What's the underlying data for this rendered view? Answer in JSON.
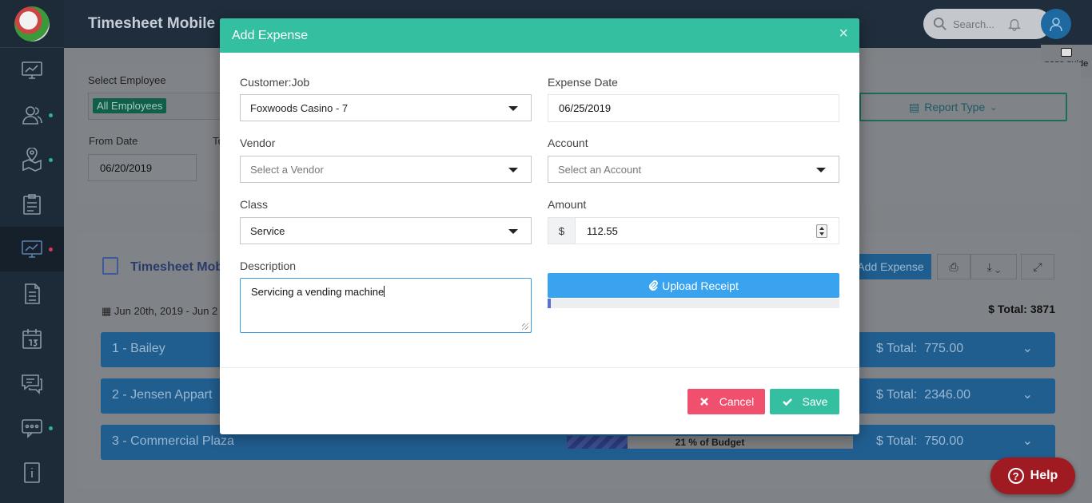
{
  "app": {
    "title": "Timesheet Mobile",
    "search_placeholder": "Search...",
    "page_guide": "page guide",
    "help_label": "Help"
  },
  "filters": {
    "select_employee_label": "Select Employee",
    "employee_chip": "All Employees",
    "from_date_label": "From Date",
    "to_date_label_partial": "To",
    "from_date_value": "06/20/2019",
    "report_type_label": "Report Type"
  },
  "main_card": {
    "title_partial": "Timesheet Mob",
    "add_expense_label": "Add Expense",
    "date_range_partial": "Jun 20th, 2019 - Jun 2",
    "total": "$ Total: 3871",
    "jobs": [
      {
        "name": "1 - Bailey",
        "total_label": "$ Total:",
        "total_value": "775.00"
      },
      {
        "name": "2 - Jensen Appart",
        "total_label": "$ Total:",
        "total_value": "2346.00"
      },
      {
        "name": "3 - Commercial Plaza",
        "total_label": "$ Total:",
        "total_value": "750.00",
        "budget_text": "21 % of Budget",
        "budget_fraction": 0.21
      }
    ]
  },
  "modal": {
    "title": "Add Expense",
    "close_glyph": "×",
    "customer_job_label": "Customer:Job",
    "customer_job_value": "Foxwoods Casino - 7",
    "expense_date_label": "Expense Date",
    "expense_date_value": "06/25/2019",
    "vendor_label": "Vendor",
    "vendor_placeholder": "Select a Vendor",
    "account_label": "Account",
    "account_placeholder": "Select an Account",
    "class_label": "Class",
    "class_value": "Service",
    "amount_label": "Amount",
    "amount_prefix": "$",
    "amount_value": "112.55",
    "description_label": "Description",
    "description_value": "Servicing a vending machine",
    "upload_label": "Upload Receipt",
    "upload_progress": 0.01,
    "cancel_label": "Cancel",
    "save_label": "Save"
  },
  "colors": {
    "modal_header": "#34bfa0",
    "upload_button": "#3aa3f0",
    "cancel_button": "#f0506e",
    "save_button": "#34bfa0",
    "help_button": "#a01a22"
  }
}
